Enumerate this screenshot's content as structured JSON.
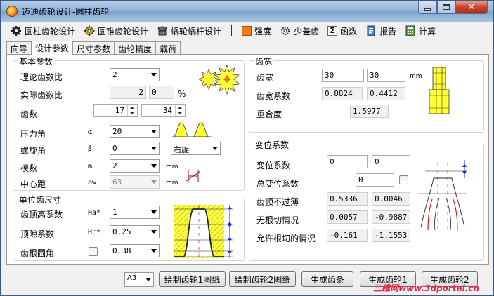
{
  "window": {
    "title": "迈迪齿轮设计-圆柱齿轮"
  },
  "toolbar": {
    "items": [
      {
        "label": "圆柱齿轮设计",
        "icon": "gear-black-icon"
      },
      {
        "label": "圆锥齿轮设计",
        "icon": "gear-bevel-icon"
      },
      {
        "label": "蜗轮蜗杆设计",
        "icon": "worm-gear-icon"
      },
      {
        "label": "强度",
        "icon": "orange-square-icon"
      },
      {
        "label": "少差齿",
        "icon": "small-gear-icon"
      },
      {
        "label": "函数",
        "icon": "sigma-icon"
      },
      {
        "label": "报告",
        "icon": "report-icon"
      },
      {
        "label": "计算",
        "icon": "calculator-icon"
      }
    ]
  },
  "tabs": [
    "向导",
    "设计参数",
    "尺寸参数",
    "齿轮精度",
    "载荷"
  ],
  "basic": {
    "title": "基本参数",
    "ratio_label": "理论齿数比",
    "ratio_value": "2",
    "actual_ratio_label": "实际齿数比",
    "actual_ratio_value": "2",
    "actual_ratio_pct": "0",
    "pct_unit": "%",
    "teeth_label": "齿数",
    "teeth1": "17",
    "teeth2": "34",
    "pressure_label": "压力角",
    "pressure_sym": "α",
    "pressure_value": "20",
    "helix_label": "螺旋角",
    "helix_sym": "β",
    "helix_value": "0",
    "hand_value": "右旋",
    "module_label": "模数",
    "module_sym": "m",
    "module_value": "2",
    "module_unit": "mm",
    "center_label": "中心距",
    "center_sym": "aw",
    "center_value": "63",
    "center_unit": "mm"
  },
  "unit_tooth": {
    "title": "单位齿尺寸",
    "addendum_label": "齿顶高系数",
    "addendum_sym": "Ha*",
    "addendum_value": "1",
    "clearance_label": "顶隙系数",
    "clearance_sym": "Hc*",
    "clearance_value": "0.25",
    "root_label": "齿根圆角",
    "root_value": "0.38"
  },
  "width": {
    "title": "齿宽",
    "width_label": "齿宽",
    "width1": "30",
    "width2": "30",
    "width_unit": "mm",
    "coef_label": "齿宽系数",
    "coef1": "0.8824",
    "coef2": "0.4412",
    "overlap_label": "重合度",
    "overlap_value": "1.5977"
  },
  "shift": {
    "title": "变位系数",
    "shift_label": "变位系数",
    "shift1": "0",
    "shift2": "0",
    "total_label": "总变位系数",
    "total_value": "0",
    "thin_label": "齿顶不过薄",
    "thin1": "0.5336",
    "thin2": "0.0046",
    "undercut_label": "无根切情况",
    "undercut1": "0.0057",
    "undercut2": "-0.9887",
    "allow_label": "允许根切的情况",
    "allow1": "-0.161",
    "allow2": "-1.1553"
  },
  "bottom": {
    "paper": "A3",
    "draw1": "绘制齿轮1图纸",
    "draw2": "绘制齿轮2图纸",
    "rack": "生成齿条",
    "gen1": "生成齿轮1",
    "gen2": "生成齿轮2",
    "watermark": "三维网www.3dportal.cn"
  }
}
